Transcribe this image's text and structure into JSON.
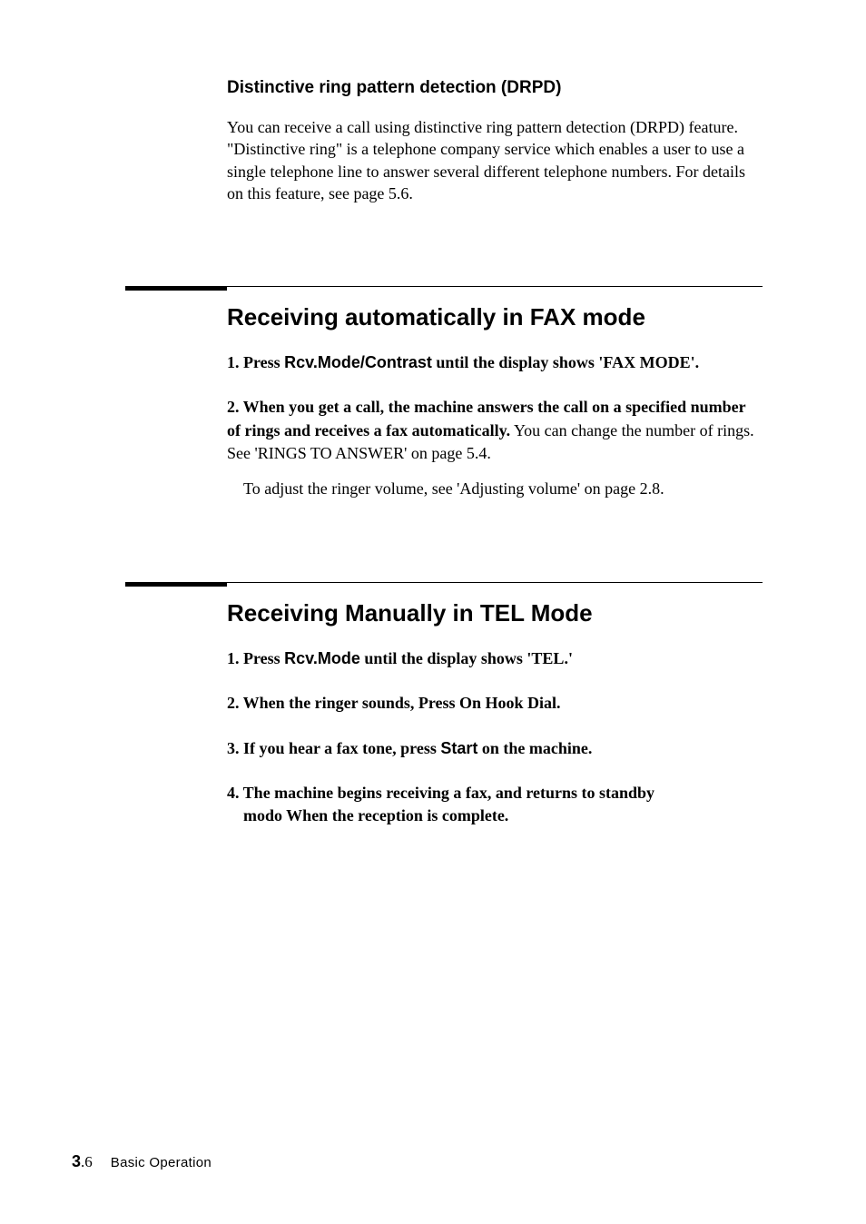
{
  "section1": {
    "heading": "Distinctive ring pattern detection (DRPD)",
    "body": "You can receive a call using distinctive ring pattern detection (DRPD) feature. \"Distinctive ring\" is a telephone company service which enables a user to use a single telephone line to answer several different telephone numbers. For details on this feature, see page 5.6."
  },
  "section2": {
    "heading": "Receiving automatically in FAX mode",
    "step1_prefix": "1. Press ",
    "step1_bold": "Rcv.Mode/Contrast",
    "step1_suffix": " until the display shows 'FAX MODE'.",
    "step2_prefix": "2. When you get a call, the machine answers the call on a specified number of rings and receives a fax automatically.",
    "step2_suffix": " You can change the number of rings. See 'RINGS TO ANSWER' on page 5.4.",
    "step2_sub": "To adjust the ringer volume, see 'Adjusting volume' on page 2.8."
  },
  "section3": {
    "heading": "Receiving Manually in TEL Mode",
    "step1_prefix": "1. Press ",
    "step1_bold": "Rcv.Mode",
    "step1_suffix": " until the display shows 'TEL.'",
    "step2": "2. When the ringer sounds, Press On Hook Dial.",
    "step3_prefix": "3. If you hear a fax tone, press ",
    "step3_bold": "Start",
    "step3_suffix": " on the machine.",
    "step4_line1": "4. The machine begins receiving a fax, and returns to standby",
    "step4_line2": "modo When the reception is complete."
  },
  "footer": {
    "page_major": "3",
    "page_minor": ".6",
    "label": "Basic Operation"
  }
}
